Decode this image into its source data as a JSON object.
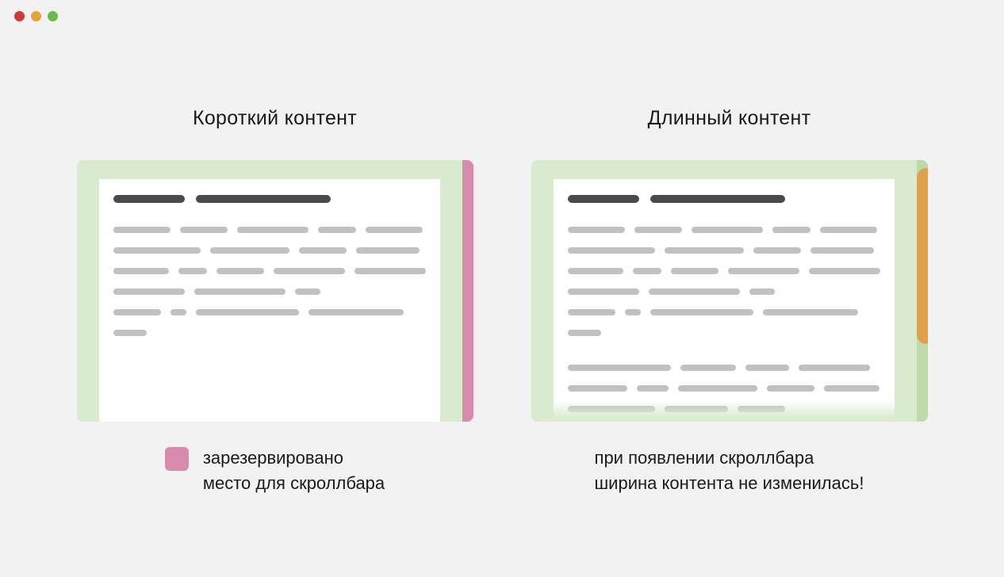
{
  "columns": {
    "left": {
      "title": "Короткий контент",
      "caption": "зарезервировано\nместо для скроллбара",
      "swatch_color": "#d88aaf"
    },
    "right": {
      "title": "Длинный контент",
      "caption": "при появлении скроллбара\nширина контента не изменилась!"
    }
  },
  "colors": {
    "window_bg": "#d8ebce",
    "scrollbar_reserved": "#d88aaf",
    "scrollbar_track": "#bedaa9",
    "scrollbar_thumb": "#e1a14a",
    "heading": "#4a4a4a",
    "text_segment": "#c1c1c1"
  }
}
